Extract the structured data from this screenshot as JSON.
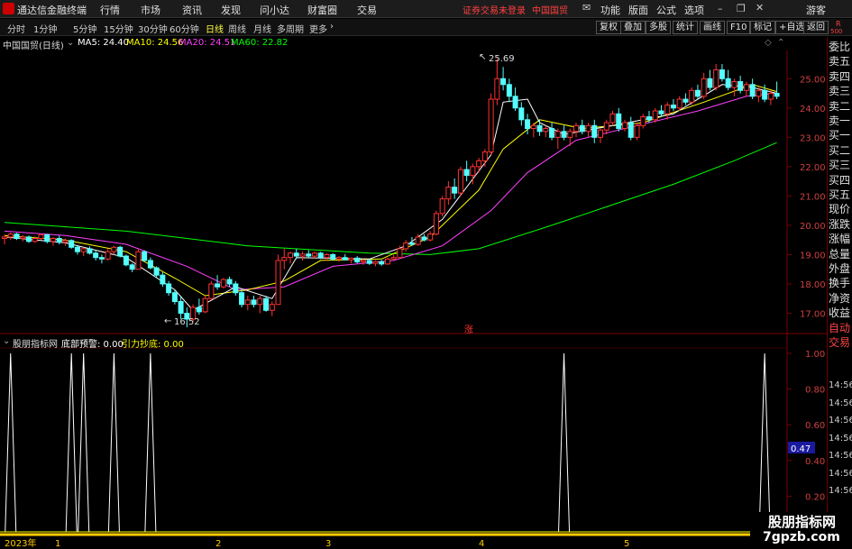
{
  "titlebar": {
    "app_name": "通达信金融终端",
    "menus": [
      "行情",
      "市场",
      "资讯",
      "发现",
      "问小达",
      "财富圈",
      "交易"
    ],
    "warning": "证券交易未登录",
    "stock_name": "中国国贸",
    "right_nav": [
      "功能",
      "版面",
      "公式",
      "选项"
    ],
    "guest": "游客"
  },
  "toolbar": {
    "periods": [
      "分时",
      "1分钟",
      "5分钟",
      "15分钟",
      "30分钟",
      "60分钟",
      "日线",
      "周线",
      "月线",
      "多周期",
      "更多"
    ],
    "active_period": "日线",
    "buttons": [
      "复权",
      "叠加",
      "多股",
      "统计",
      "画线",
      "F10",
      "标记",
      "+自选",
      "返回"
    ],
    "corner_top": "R",
    "corner_bottom": "500"
  },
  "main_legend": {
    "stock": "中国国贸(日线)",
    "ma5": "MA5: 24.40",
    "ma10": "MA10: 24.56",
    "ma20": "MA20: 24.51",
    "ma60": "MA60: 22.82"
  },
  "price_axis": [
    "25.00",
    "24.00",
    "23.00",
    "22.00",
    "21.00",
    "20.00",
    "19.00",
    "18.00",
    "17.00"
  ],
  "annotations": {
    "high": "25.69",
    "low": "16.52",
    "limit_up_mark": "涨"
  },
  "right_panel": [
    "委比",
    "卖五",
    "卖四",
    "卖三",
    "卖二",
    "卖一",
    "买一",
    "买二",
    "买三",
    "买四",
    "买五",
    "现价",
    "涨跌",
    "涨幅",
    "总量",
    "外盘",
    "换手",
    "净资",
    "收益",
    "自动",
    "交易"
  ],
  "right_times": [
    "14:56",
    "14:56",
    "14:56",
    "14:56",
    "14:56",
    "14:56",
    "14:56"
  ],
  "indicator": {
    "name": "股朋指标网",
    "label1": "底部预警: 0.00",
    "label2": "引力抄底: 0.00",
    "axis": [
      "1.00",
      "0.80",
      "0.60",
      "0.40",
      "0.20"
    ],
    "current": "0.47"
  },
  "date_axis": {
    "year": "2023年",
    "months": [
      "1",
      "2",
      "3",
      "4",
      "5"
    ]
  },
  "watermark": {
    "line1": "股朋指标网",
    "line2": "7gpzb.com"
  },
  "colors": {
    "up": "#ff3232",
    "down": "#54ffff",
    "ma5": "#ffffff",
    "ma10": "#ffff00",
    "ma20": "#ff40ff",
    "ma60": "#00ff00"
  },
  "chart_data": {
    "type": "candlestick",
    "ylim": [
      16.4,
      25.9
    ],
    "candles": [
      [
        19.55,
        19.68,
        19.35,
        19.6
      ],
      [
        19.6,
        19.75,
        19.5,
        19.7
      ],
      [
        19.7,
        19.74,
        19.5,
        19.55
      ],
      [
        19.55,
        19.66,
        19.45,
        19.6
      ],
      [
        19.6,
        19.65,
        19.4,
        19.45
      ],
      [
        19.45,
        19.62,
        19.4,
        19.55
      ],
      [
        19.55,
        19.72,
        19.5,
        19.68
      ],
      [
        19.68,
        19.7,
        19.38,
        19.45
      ],
      [
        19.45,
        19.6,
        19.3,
        19.55
      ],
      [
        19.55,
        19.65,
        19.35,
        19.42
      ],
      [
        19.42,
        19.55,
        19.3,
        19.48
      ],
      [
        19.48,
        19.52,
        19.2,
        19.25
      ],
      [
        19.25,
        19.32,
        19.0,
        19.1
      ],
      [
        19.1,
        19.25,
        18.95,
        19.2
      ],
      [
        19.2,
        19.28,
        19.0,
        19.05
      ],
      [
        19.05,
        19.15,
        18.8,
        18.9
      ],
      [
        18.9,
        19.0,
        18.7,
        18.85
      ],
      [
        18.85,
        19.2,
        18.8,
        19.1
      ],
      [
        19.1,
        19.3,
        19.0,
        19.25
      ],
      [
        19.25,
        19.3,
        18.9,
        18.95
      ],
      [
        18.95,
        19.0,
        18.6,
        18.65
      ],
      [
        18.65,
        18.7,
        18.4,
        18.5
      ],
      [
        18.5,
        19.2,
        18.5,
        19.1
      ],
      [
        19.1,
        19.15,
        18.75,
        18.8
      ],
      [
        18.8,
        18.9,
        18.5,
        18.55
      ],
      [
        18.55,
        18.6,
        18.2,
        18.3
      ],
      [
        18.3,
        18.4,
        17.9,
        18.0
      ],
      [
        18.0,
        18.1,
        17.6,
        17.7
      ],
      [
        17.7,
        17.8,
        17.3,
        17.4
      ],
      [
        17.4,
        17.6,
        16.8,
        17.0
      ],
      [
        17.0,
        17.2,
        16.52,
        16.8
      ],
      [
        16.8,
        17.3,
        16.7,
        17.2
      ],
      [
        17.2,
        17.5,
        16.95,
        17.05
      ],
      [
        17.05,
        17.6,
        17.0,
        17.5
      ],
      [
        17.5,
        18.1,
        17.45,
        18.0
      ],
      [
        18.0,
        18.3,
        17.8,
        17.9
      ],
      [
        17.9,
        18.2,
        17.85,
        18.15
      ],
      [
        18.15,
        18.25,
        17.9,
        18.0
      ],
      [
        18.0,
        18.1,
        17.6,
        17.7
      ],
      [
        17.7,
        17.8,
        17.2,
        17.3
      ],
      [
        17.3,
        17.6,
        17.1,
        17.45
      ],
      [
        17.45,
        17.6,
        17.2,
        17.3
      ],
      [
        17.3,
        17.6,
        17.0,
        17.5
      ],
      [
        17.5,
        17.6,
        17.05,
        17.1
      ],
      [
        17.1,
        17.4,
        16.9,
        17.3
      ],
      [
        17.3,
        19.0,
        17.3,
        18.8
      ],
      [
        18.8,
        19.2,
        18.5,
        18.9
      ],
      [
        18.9,
        19.1,
        18.7,
        19.05
      ],
      [
        19.05,
        19.2,
        18.85,
        18.95
      ],
      [
        18.95,
        19.1,
        18.8,
        19.02
      ],
      [
        19.02,
        19.15,
        18.9,
        18.95
      ],
      [
        18.95,
        19.1,
        18.85,
        19.05
      ],
      [
        19.05,
        19.1,
        18.85,
        18.9
      ],
      [
        18.9,
        19.05,
        18.8,
        19.0
      ],
      [
        19.0,
        19.05,
        18.8,
        18.85
      ],
      [
        18.85,
        18.95,
        18.75,
        18.9
      ],
      [
        18.9,
        19.02,
        18.8,
        18.82
      ],
      [
        18.82,
        18.9,
        18.7,
        18.88
      ],
      [
        18.88,
        18.95,
        18.7,
        18.75
      ],
      [
        18.75,
        18.85,
        18.65,
        18.8
      ],
      [
        18.8,
        18.85,
        18.65,
        18.7
      ],
      [
        18.7,
        18.8,
        18.6,
        18.76
      ],
      [
        18.76,
        18.82,
        18.62,
        18.68
      ],
      [
        18.68,
        18.9,
        18.65,
        18.85
      ],
      [
        18.85,
        19.0,
        18.8,
        18.9
      ],
      [
        18.9,
        19.3,
        18.85,
        19.2
      ],
      [
        19.2,
        19.5,
        19.1,
        19.4
      ],
      [
        19.4,
        19.6,
        19.3,
        19.35
      ],
      [
        19.35,
        19.7,
        19.3,
        19.6
      ],
      [
        19.6,
        19.7,
        19.45,
        19.5
      ],
      [
        19.5,
        19.8,
        19.45,
        19.7
      ],
      [
        19.7,
        20.5,
        19.65,
        20.4
      ],
      [
        20.4,
        21.0,
        20.3,
        20.9
      ],
      [
        20.9,
        21.5,
        20.7,
        21.3
      ],
      [
        21.3,
        21.6,
        20.9,
        21.1
      ],
      [
        21.1,
        22.0,
        21.0,
        21.9
      ],
      [
        21.9,
        22.2,
        21.5,
        21.7
      ],
      [
        21.7,
        22.1,
        21.4,
        22.0
      ],
      [
        22.0,
        22.3,
        21.8,
        22.2
      ],
      [
        22.2,
        22.6,
        22.0,
        22.5
      ],
      [
        22.5,
        24.5,
        22.4,
        24.3
      ],
      [
        24.3,
        25.69,
        24.1,
        25.0
      ],
      [
        25.0,
        25.4,
        24.6,
        24.8
      ],
      [
        24.8,
        25.0,
        24.2,
        24.4
      ],
      [
        24.4,
        24.7,
        23.9,
        24.0
      ],
      [
        24.0,
        24.2,
        23.4,
        23.6
      ],
      [
        23.6,
        23.8,
        23.1,
        23.3
      ],
      [
        23.3,
        23.5,
        23.0,
        23.4
      ],
      [
        23.4,
        23.6,
        23.05,
        23.2
      ],
      [
        23.2,
        23.4,
        23.0,
        23.3
      ],
      [
        23.3,
        23.5,
        22.9,
        23.0
      ],
      [
        23.0,
        23.3,
        22.6,
        23.2
      ],
      [
        23.2,
        23.4,
        22.9,
        23.0
      ],
      [
        23.0,
        23.3,
        22.7,
        23.2
      ],
      [
        23.2,
        23.5,
        23.0,
        23.4
      ],
      [
        23.4,
        23.6,
        23.1,
        23.2
      ],
      [
        23.2,
        23.5,
        23.0,
        23.4
      ],
      [
        23.4,
        23.6,
        22.8,
        23.0
      ],
      [
        23.0,
        23.3,
        22.8,
        23.25
      ],
      [
        23.25,
        23.6,
        23.1,
        23.5
      ],
      [
        23.5,
        23.9,
        23.4,
        23.8
      ],
      [
        23.8,
        24.0,
        23.2,
        23.3
      ],
      [
        23.3,
        23.6,
        23.2,
        23.5
      ],
      [
        23.5,
        23.7,
        22.9,
        23.0
      ],
      [
        23.0,
        23.5,
        22.9,
        23.4
      ],
      [
        23.4,
        23.8,
        23.3,
        23.7
      ],
      [
        23.7,
        23.9,
        23.5,
        23.6
      ],
      [
        23.6,
        24.0,
        23.5,
        23.9
      ],
      [
        23.9,
        24.1,
        23.7,
        23.8
      ],
      [
        23.8,
        24.2,
        23.6,
        24.1
      ],
      [
        24.1,
        24.3,
        23.9,
        24.0
      ],
      [
        24.0,
        24.4,
        23.9,
        24.3
      ],
      [
        24.3,
        24.5,
        24.1,
        24.2
      ],
      [
        24.2,
        24.7,
        24.1,
        24.6
      ],
      [
        24.6,
        24.8,
        24.3,
        24.4
      ],
      [
        24.4,
        25.2,
        24.3,
        25.0
      ],
      [
        25.0,
        25.3,
        24.6,
        24.7
      ],
      [
        24.7,
        25.5,
        24.6,
        25.3
      ],
      [
        25.3,
        25.5,
        24.9,
        25.0
      ],
      [
        25.0,
        25.3,
        24.6,
        24.7
      ],
      [
        24.7,
        25.0,
        24.4,
        24.9
      ],
      [
        24.9,
        25.1,
        24.5,
        24.6
      ],
      [
        24.6,
        24.9,
        24.4,
        24.8
      ],
      [
        24.8,
        25.0,
        24.3,
        24.4
      ],
      [
        24.4,
        24.7,
        24.2,
        24.6
      ],
      [
        24.6,
        24.8,
        24.2,
        24.3
      ],
      [
        24.3,
        24.6,
        24.1,
        24.5
      ],
      [
        24.5,
        24.9,
        24.3,
        24.4
      ]
    ],
    "ma5": [
      [
        0,
        19.6
      ],
      [
        10,
        19.4
      ],
      [
        20,
        18.9
      ],
      [
        28,
        17.8
      ],
      [
        31,
        17.1
      ],
      [
        38,
        17.9
      ],
      [
        44,
        17.5
      ],
      [
        48,
        18.9
      ],
      [
        60,
        18.85
      ],
      [
        66,
        19.3
      ],
      [
        72,
        20.2
      ],
      [
        80,
        22.4
      ],
      [
        82,
        24.2
      ],
      [
        86,
        24.3
      ],
      [
        88,
        23.5
      ],
      [
        92,
        23.1
      ],
      [
        100,
        23.4
      ],
      [
        110,
        23.8
      ],
      [
        118,
        24.8
      ],
      [
        123,
        24.7
      ],
      [
        127,
        24.5
      ]
    ],
    "ma10": [
      [
        0,
        19.65
      ],
      [
        10,
        19.5
      ],
      [
        20,
        19.1
      ],
      [
        28,
        18.2
      ],
      [
        33,
        17.6
      ],
      [
        40,
        17.8
      ],
      [
        46,
        18.1
      ],
      [
        52,
        18.8
      ],
      [
        62,
        18.85
      ],
      [
        70,
        19.6
      ],
      [
        78,
        21.2
      ],
      [
        82,
        22.6
      ],
      [
        88,
        23.6
      ],
      [
        95,
        23.3
      ],
      [
        105,
        23.5
      ],
      [
        115,
        24.2
      ],
      [
        123,
        24.8
      ],
      [
        127,
        24.56
      ]
    ],
    "ma20": [
      [
        0,
        19.8
      ],
      [
        10,
        19.65
      ],
      [
        20,
        19.35
      ],
      [
        30,
        18.6
      ],
      [
        38,
        17.8
      ],
      [
        46,
        17.9
      ],
      [
        54,
        18.6
      ],
      [
        64,
        18.8
      ],
      [
        72,
        19.3
      ],
      [
        80,
        20.5
      ],
      [
        86,
        21.8
      ],
      [
        94,
        22.9
      ],
      [
        104,
        23.4
      ],
      [
        114,
        23.9
      ],
      [
        122,
        24.4
      ],
      [
        127,
        24.51
      ]
    ],
    "ma60": [
      [
        0,
        20.1
      ],
      [
        20,
        19.8
      ],
      [
        40,
        19.3
      ],
      [
        60,
        19.05
      ],
      [
        70,
        19.0
      ],
      [
        78,
        19.2
      ],
      [
        90,
        20.0
      ],
      [
        100,
        20.7
      ],
      [
        110,
        21.4
      ],
      [
        120,
        22.2
      ],
      [
        127,
        22.82
      ]
    ],
    "indicator_spikes": [
      1,
      11,
      13,
      18,
      24,
      92,
      125
    ]
  }
}
